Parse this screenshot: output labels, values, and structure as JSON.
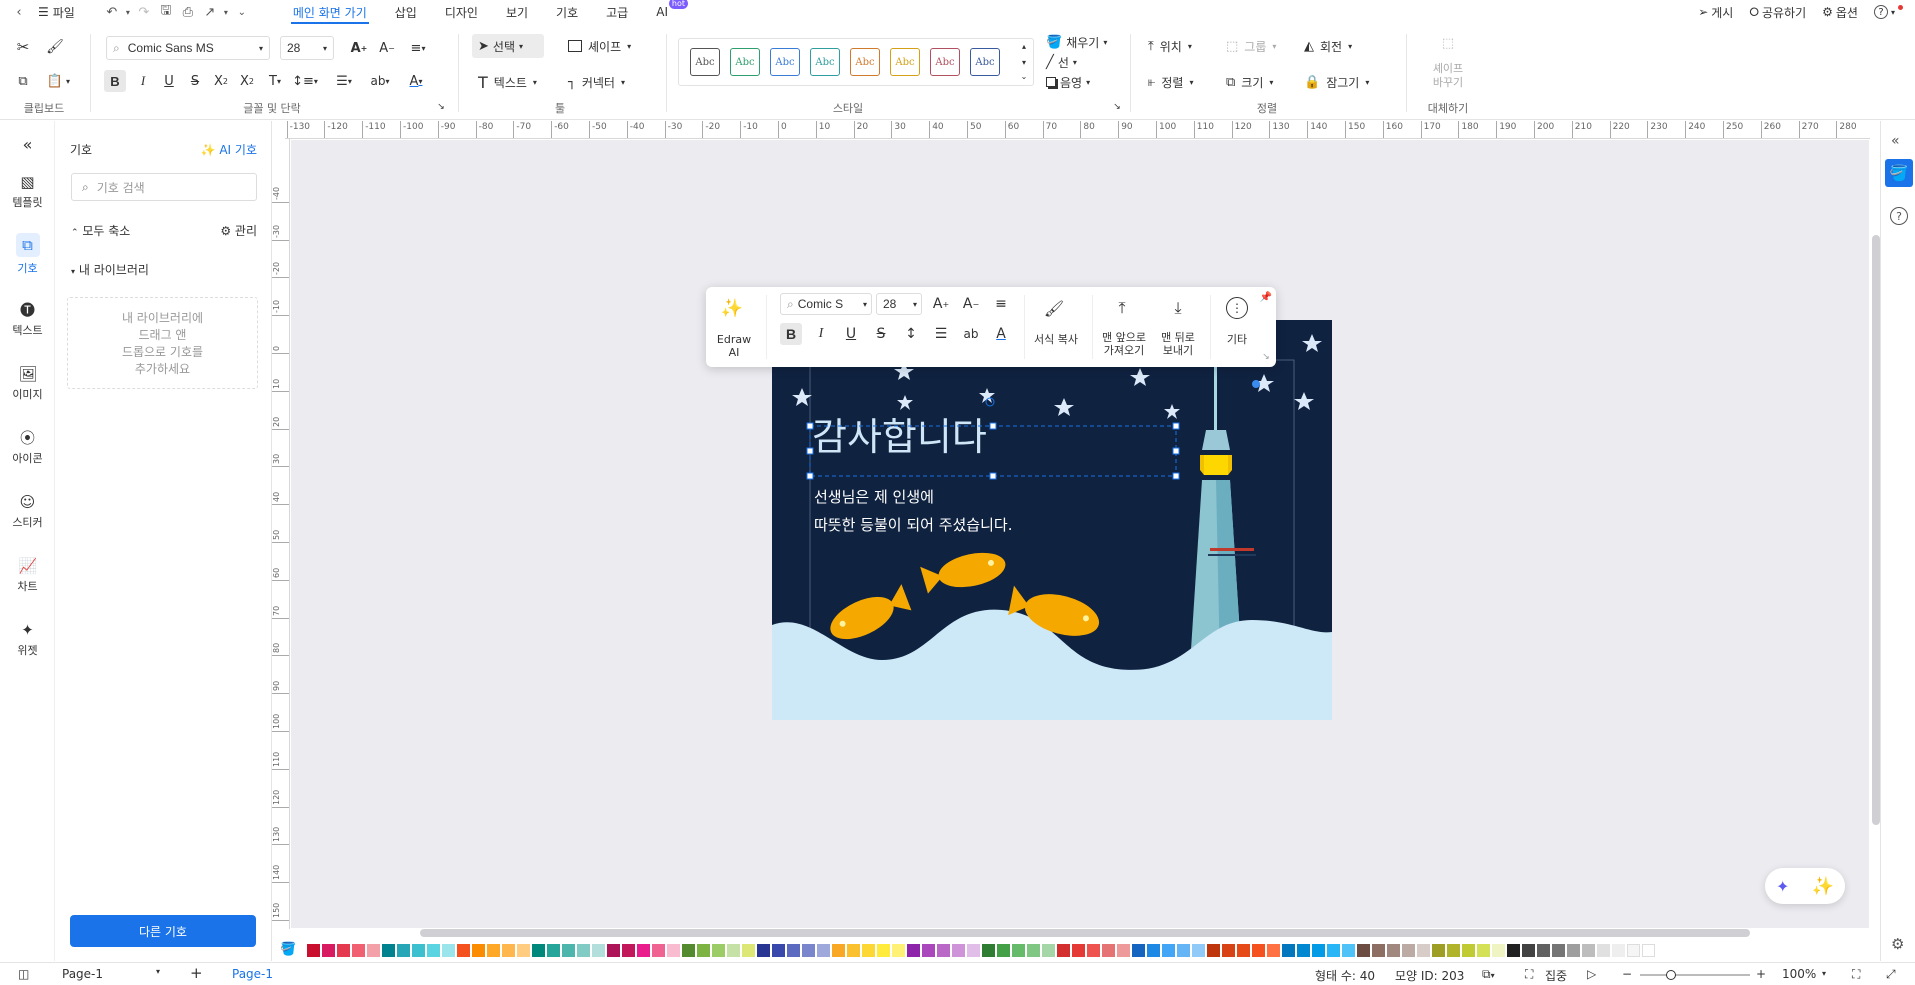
{
  "menubar": {
    "file_label": "파일",
    "tabs": [
      {
        "label": "메인 화면 가기",
        "active": true
      },
      {
        "label": "삽입"
      },
      {
        "label": "디자인"
      },
      {
        "label": "보기"
      },
      {
        "label": "기호"
      },
      {
        "label": "고급"
      },
      {
        "label": "AI",
        "badge": "hot"
      }
    ],
    "right": {
      "publish": "게시",
      "share": "공유하기",
      "options": "옵션",
      "help": "?"
    }
  },
  "ribbon": {
    "font_family": "Comic Sans MS",
    "font_size": "28",
    "select_label": "선택",
    "shape_label": "셰이프",
    "text_label": "텍스트",
    "connector_label": "커넥터",
    "fill_label": "채우기",
    "line_label": "선",
    "shadow_label": "음영",
    "position_label": "위치",
    "group_label": "그룹",
    "rotate_label": "회전",
    "align_label": "정렬",
    "size_label": "크기",
    "lock_label": "잠그기",
    "replace_label_1": "셰이프",
    "replace_label_2": "바꾸기",
    "style_sample": "Abc",
    "style_colors": [
      "#555555",
      "#2e9e6e",
      "#3a7bd5",
      "#2e9e9e",
      "#d07a2e",
      "#d4a017",
      "#b05060",
      "#3a5a9e"
    ],
    "groups": {
      "clipboard": "클립보드",
      "font": "글꼴 및 단락",
      "tools": "툴",
      "style": "스타일",
      "arrange": "정렬",
      "replace": "대체하기"
    }
  },
  "rail": [
    {
      "label": "템플릿",
      "icon": "template-icon"
    },
    {
      "label": "기호",
      "icon": "symbol-icon",
      "active": true
    },
    {
      "label": "텍스트",
      "icon": "text-icon"
    },
    {
      "label": "이미지",
      "icon": "image-icon"
    },
    {
      "label": "아이콘",
      "icon": "icon-icon"
    },
    {
      "label": "스티커",
      "icon": "sticker-icon"
    },
    {
      "label": "차트",
      "icon": "chart-icon"
    },
    {
      "label": "위젯",
      "icon": "widget-icon"
    }
  ],
  "panel": {
    "title": "기호",
    "ai_label": "AI 기호",
    "search_placeholder": "기호 검색",
    "collapse_label": "모두 축소",
    "manage_label": "관리",
    "my_library": "내 라이브러리",
    "drop_line1": "내 라이브러리에",
    "drop_line2": "드래그 앤",
    "drop_line3": "드롭으로 기호를",
    "drop_line4": "추가하세요",
    "more_button": "다른 기호"
  },
  "floatbar": {
    "edraw_ai": "Edraw AI",
    "font_family": "Comic S",
    "font_size": "28",
    "format_copy": "서식 복사",
    "bring_front_1": "맨 앞으로",
    "bring_front_2": "가져오기",
    "send_back_1": "맨 뒤로",
    "send_back_2": "보내기",
    "more": "기타"
  },
  "card": {
    "title": "감사합니다",
    "line1": "선생님은 제 인생에",
    "line2": "따뜻한 등불이 되어 주셨습니다.",
    "bg_color": "#0f2240",
    "wave_color": "#cde8f6",
    "fish_color": "#f5a800"
  },
  "ruler": {
    "h_ticks": [
      "-130",
      "-120",
      "-110",
      "-100",
      "-90",
      "-80",
      "-70",
      "-60",
      "-50",
      "-40",
      "-30",
      "-20",
      "-10",
      "0",
      "10",
      "20",
      "30",
      "40",
      "50",
      "60",
      "70",
      "80",
      "90",
      "100",
      "110",
      "120",
      "130",
      "140",
      "150",
      "160",
      "170",
      "180",
      "190",
      "200",
      "210",
      "220",
      "230",
      "240",
      "250",
      "260",
      "270",
      "280"
    ],
    "v_ticks": [
      "-40",
      "-30",
      "-20",
      "-10",
      "0",
      "10",
      "20",
      "30",
      "40",
      "50",
      "60",
      "70",
      "80",
      "90",
      "100",
      "110",
      "120",
      "130",
      "140",
      "150"
    ]
  },
  "palette": [
    "#c8102e",
    "#d81b60",
    "#e53950",
    "#f06070",
    "#f4a0a8",
    "#00838f",
    "#26a6b6",
    "#3cc0d0",
    "#5ad4e0",
    "#9ae4ec",
    "#f4511e",
    "#fb8c00",
    "#ffa726",
    "#ffb74d",
    "#ffcc80",
    "#00897b",
    "#26a69a",
    "#4db6ac",
    "#80cbc4",
    "#b2dfdb",
    "#ad1457",
    "#c2185b",
    "#e91e8c",
    "#f06292",
    "#f8bbd0",
    "#558b2f",
    "#7cb342",
    "#9ccc65",
    "#c5e1a5",
    "#dce775",
    "#283593",
    "#3949ab",
    "#5c6bc0",
    "#7986cb",
    "#9fa8da",
    "#f9a825",
    "#fbc02d",
    "#fdd835",
    "#ffeb3b",
    "#fff176",
    "#8e24aa",
    "#ab47bc",
    "#ba68c8",
    "#ce93d8",
    "#e1bee7",
    "#2e7d32",
    "#43a047",
    "#66bb6a",
    "#81c784",
    "#a5d6a7",
    "#d32f2f",
    "#e53935",
    "#ef5350",
    "#e57373",
    "#ef9a9a",
    "#1565c0",
    "#1e88e5",
    "#42a5f5",
    "#64b5f6",
    "#90caf9",
    "#bf360c",
    "#d84315",
    "#e64a19",
    "#f4511e",
    "#ff7043",
    "#0277bd",
    "#0288d1",
    "#039be5",
    "#29b6f6",
    "#4fc3f7",
    "#6d4c41",
    "#8d6e63",
    "#a1887f",
    "#bcaaa4",
    "#d7ccc8",
    "#9e9d24",
    "#afb42b",
    "#c0ca33",
    "#d4e157",
    "#f0f4c3",
    "#212121",
    "#424242",
    "#616161",
    "#757575",
    "#9e9e9e",
    "#bdbdbd",
    "#e0e0e0",
    "#eeeeee",
    "#f5f5f5",
    "#ffffff"
  ],
  "status": {
    "page_select": "Page-1",
    "page_tab": "Page-1",
    "shape_count": "형태 수: 40",
    "shape_id": "모양 ID: 203",
    "focus": "집중",
    "zoom": "100%"
  }
}
